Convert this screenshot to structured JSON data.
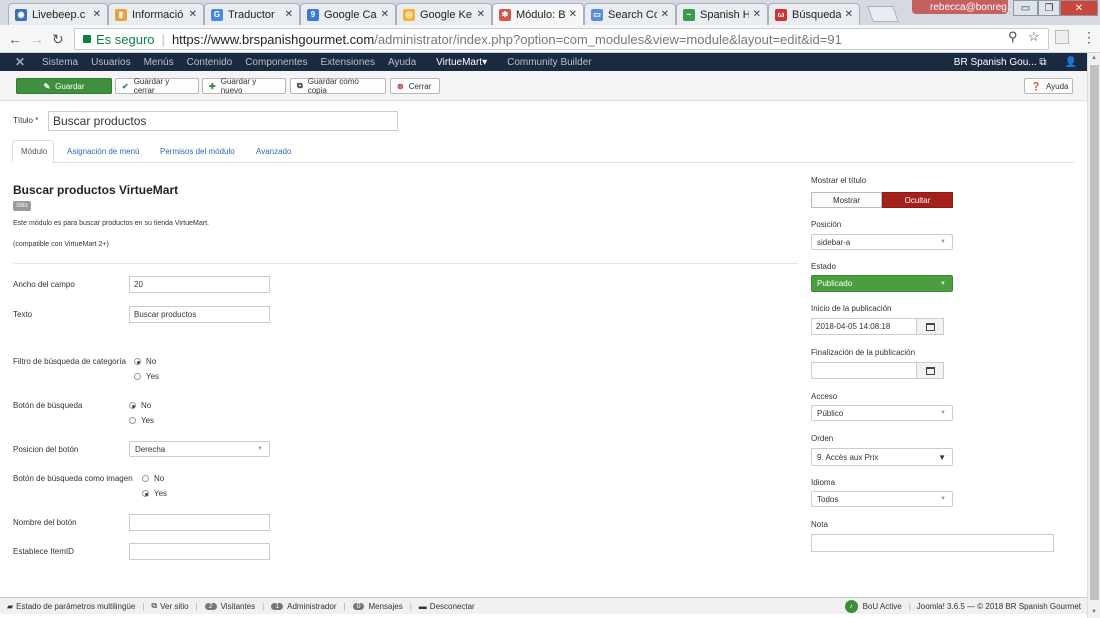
{
  "browser": {
    "tabs": [
      {
        "label": "Livebeep.c",
        "icon": "rss-icon",
        "color": "#3b6fb6"
      },
      {
        "label": "Informació",
        "icon": "chart-icon",
        "color": "#e9a23b"
      },
      {
        "label": "Traductor",
        "icon": "translate-icon",
        "color": "#4a88e0"
      },
      {
        "label": "Google Ca",
        "icon": "calendar-icon",
        "color": "#3c78d8"
      },
      {
        "label": "Google Ke",
        "icon": "keyword-icon",
        "color": "#f2b631"
      },
      {
        "label": "Módulo: B",
        "icon": "joomla-icon",
        "color": "#d9534f"
      },
      {
        "label": "Search Co",
        "icon": "search-console-icon",
        "color": "#5b8ed8"
      },
      {
        "label": "Spanish H",
        "icon": "spanish-icon",
        "color": "#3a9b4c"
      },
      {
        "label": "Búsqueda",
        "icon": "search-icon",
        "color": "#cc3333"
      }
    ],
    "profile_name": "rebecca@bonreg...",
    "secure_label": "Es seguro",
    "url_host": "https://www.brspanishgourmet.com",
    "url_path": "/administrator/index.php?option=com_modules&view=module&layout=edit&id=91"
  },
  "nav": {
    "items": [
      "Sistema",
      "Usuarios",
      "Menús",
      "Contenido",
      "Componentes",
      "Extensiones",
      "Ayuda"
    ],
    "virtuemart": "VirtueMart▾",
    "community": "Community Builder",
    "site_name": "BR Spanish Gou...",
    "external_glyph": "⧉",
    "user_glyph": "👤"
  },
  "toolbar": {
    "save": "Guardar",
    "save_close": "Guardar y cerrar",
    "save_new": "Guardar y nuevo",
    "save_copy": "Guardar como copia",
    "close": "Cerrar",
    "help": "Ayuda"
  },
  "form": {
    "title_label": "Título *",
    "title_value": "Buscar productos",
    "tabs": [
      "Módulo",
      "Asignación de menú",
      "Permisos del módulo",
      "Avanzado"
    ],
    "module_title": "Buscar productos VirtueMart",
    "badge": "Sitio",
    "description": "Este módulo es para buscar productos en su tienda VirtueMart.",
    "compat": "(compatible con VirtueMart 2+)",
    "fields": {
      "width_label": "Ancho del campo",
      "width_value": "20",
      "text_label": "Texto",
      "text_value": "Buscar productos",
      "cat_filter_label": "Filtro de búsqueda de categoría",
      "search_btn_label": "Botón de búsqueda",
      "btn_position_label": "Posicion del botón",
      "btn_position_value": "Derecha",
      "img_btn_label": "Botón de búsqueda como imagen",
      "btn_name_label": "Nombre del botón",
      "itemid_label": "Establece ItemID",
      "opt_no": "No",
      "opt_yes": "Yes"
    }
  },
  "side": {
    "show_title_label": "Mostrar el título",
    "show": "Mostrar",
    "hide": "Ocultar",
    "position_label": "Posición",
    "position_value": "sidebar-a",
    "state_label": "Estado",
    "state_value": "Publicado",
    "pub_start_label": "Inicio de la publicación",
    "pub_start_value": "2018-04-05 14:08:18",
    "pub_end_label": "Finalización de la publicación",
    "access_label": "Acceso",
    "access_value": "Público",
    "order_label": "Orden",
    "order_value": "9. Accès aux Prix",
    "lang_label": "Idioma",
    "lang_value": "Todos",
    "note_label": "Nota"
  },
  "footer": {
    "multilang": "Estado de parámetros multilingüe",
    "view_site": "Ver sitio",
    "visitors_count": "2",
    "visitors": "Visitantes",
    "admin_count": "1",
    "admin": "Administrador",
    "messages_count": "0",
    "messages": "Mensajes",
    "logout": "Desconectar",
    "bou": "BoU Active",
    "version": "Joomla! 3.6.5 — © 2018 BR Spanish Gourmet"
  }
}
